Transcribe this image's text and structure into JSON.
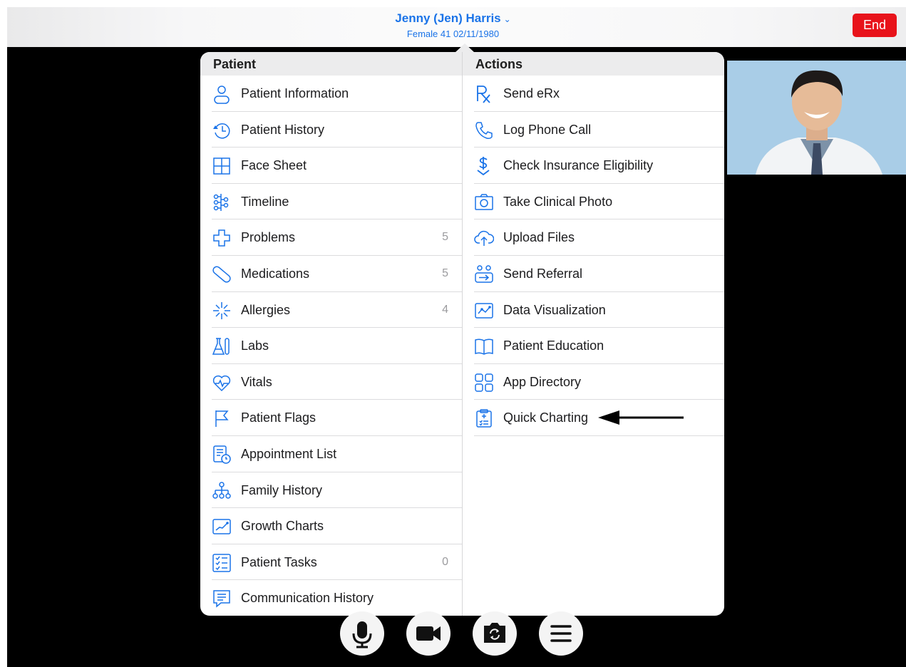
{
  "header": {
    "patient_name": "Jenny (Jen) Harris",
    "patient_demographics": "Female 41 02/11/1980",
    "end_button_label": "End"
  },
  "popover": {
    "left_column": {
      "title": "Patient",
      "items": [
        {
          "label": "Patient Information",
          "icon": "person-icon",
          "count": ""
        },
        {
          "label": "Patient History",
          "icon": "history-clock-icon",
          "count": ""
        },
        {
          "label": "Face Sheet",
          "icon": "grid-icon",
          "count": ""
        },
        {
          "label": "Timeline",
          "icon": "timeline-icon",
          "count": ""
        },
        {
          "label": "Problems",
          "icon": "medical-cross-icon",
          "count": "5"
        },
        {
          "label": "Medications",
          "icon": "pill-icon",
          "count": "5"
        },
        {
          "label": "Allergies",
          "icon": "allergy-burst-icon",
          "count": "4"
        },
        {
          "label": "Labs",
          "icon": "flask-icon",
          "count": ""
        },
        {
          "label": "Vitals",
          "icon": "heart-pulse-icon",
          "count": ""
        },
        {
          "label": "Patient Flags",
          "icon": "flag-icon",
          "count": ""
        },
        {
          "label": "Appointment List",
          "icon": "calendar-clock-icon",
          "count": ""
        },
        {
          "label": "Family History",
          "icon": "family-tree-icon",
          "count": ""
        },
        {
          "label": "Growth Charts",
          "icon": "chart-line-icon",
          "count": ""
        },
        {
          "label": "Patient Tasks",
          "icon": "checklist-icon",
          "count": "0"
        },
        {
          "label": "Communication History",
          "icon": "chat-bubble-icon",
          "count": ""
        }
      ]
    },
    "right_column": {
      "title": "Actions",
      "items": [
        {
          "label": "Send eRx",
          "icon": "rx-icon"
        },
        {
          "label": "Log Phone Call",
          "icon": "phone-icon"
        },
        {
          "label": "Check Insurance Eligibility",
          "icon": "dollar-check-icon"
        },
        {
          "label": "Take Clinical Photo",
          "icon": "camera-icon"
        },
        {
          "label": "Upload Files",
          "icon": "cloud-upload-icon"
        },
        {
          "label": "Send Referral",
          "icon": "referral-icon"
        },
        {
          "label": "Data Visualization",
          "icon": "chart-line-icon"
        },
        {
          "label": "Patient Education",
          "icon": "book-icon"
        },
        {
          "label": "App Directory",
          "icon": "app-grid-icon"
        },
        {
          "label": "Quick Charting",
          "icon": "clipboard-icon"
        }
      ]
    }
  },
  "call_controls": [
    {
      "icon": "microphone-icon"
    },
    {
      "icon": "video-camera-icon"
    },
    {
      "icon": "switch-camera-icon"
    },
    {
      "icon": "menu-icon"
    }
  ],
  "colors": {
    "accent": "#1a73e8",
    "end_button": "#e8131b",
    "header_band": "#ececed"
  }
}
